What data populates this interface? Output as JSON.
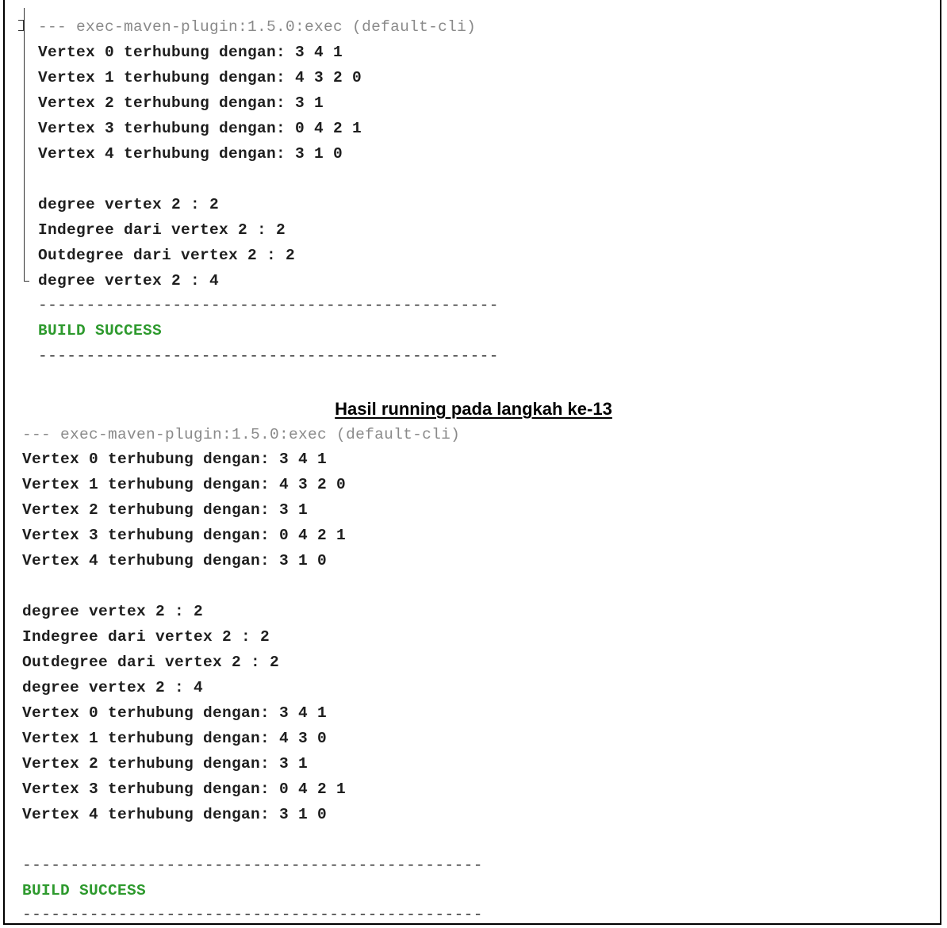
{
  "output1": {
    "header": "--- exec-maven-plugin:1.5.0:exec (default-cli)",
    "lines": [
      "Vertex 0 terhubung dengan: 3 4 1",
      "Vertex 1 terhubung dengan: 4 3 2 0",
      "Vertex 2 terhubung dengan: 3 1",
      "Vertex 3 terhubung dengan: 0 4 2 1",
      "Vertex 4 terhubung dengan: 3 1 0",
      "",
      "degree vertex 2 : 2",
      "Indegree dari vertex 2 : 2",
      "Outdegree dari vertex 2 : 2",
      "degree vertex 2 : 4"
    ],
    "separator": "------------------------------------------------",
    "build_status": "BUILD SUCCESS"
  },
  "caption": "Hasil running pada langkah ke-13",
  "output2": {
    "header": "--- exec-maven-plugin:1.5.0:exec (default-cli)",
    "lines": [
      "Vertex 0 terhubung dengan: 3 4 1",
      "Vertex 1 terhubung dengan: 4 3 2 0",
      "Vertex 2 terhubung dengan: 3 1",
      "Vertex 3 terhubung dengan: 0 4 2 1",
      "Vertex 4 terhubung dengan: 3 1 0",
      "",
      "degree vertex 2 : 2",
      "Indegree dari vertex 2 : 2",
      "Outdegree dari vertex 2 : 2",
      "degree vertex 2 : 4",
      "Vertex 0 terhubung dengan: 3 4 1",
      "Vertex 1 terhubung dengan: 4 3 0",
      "Vertex 2 terhubung dengan: 3 1",
      "Vertex 3 terhubung dengan: 0 4 2 1",
      "Vertex 4 terhubung dengan: 3 1 0",
      ""
    ],
    "separator": "------------------------------------------------",
    "build_status": "BUILD SUCCESS"
  }
}
